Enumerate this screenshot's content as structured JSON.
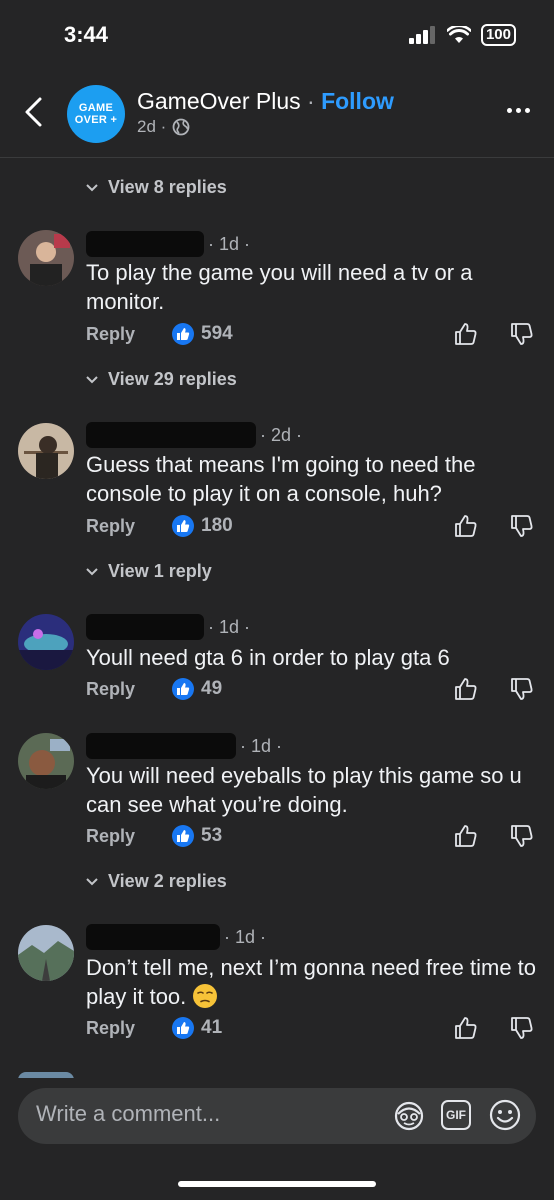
{
  "status_bar": {
    "time": "3:44",
    "battery": "100"
  },
  "header": {
    "page_name": "GameOver Plus",
    "separator": "·",
    "follow_label": "Follow",
    "post_age": "2d ·",
    "logo_line1": "GAME",
    "logo_line2": "OVER +"
  },
  "comments": [
    {
      "replies_toggle": "View 8 replies",
      "name_suffix": "· 1d ·",
      "text": "To play the game you will need a tv or a monitor.",
      "reply_label": "Reply",
      "likes": "594",
      "avatar_color": "#6c5a55"
    },
    {
      "replies_toggle": "View 29 replies",
      "name_suffix": "· 2d ·",
      "text": "Guess that means I'm going to need the console to play it on a console, huh?",
      "reply_label": "Reply",
      "likes": "180",
      "avatar_color": "#c8b8a4"
    },
    {
      "replies_toggle": "View 1 reply",
      "name_suffix": "· 1d ·",
      "text": "Youll need gta 6 in order to play gta 6",
      "reply_label": "Reply",
      "likes": "49",
      "avatar_color": "#3a3f9c"
    },
    {
      "replies_toggle": "",
      "name_suffix": "· 1d ·",
      "text": "You will need eyeballs to play this game so u can see what you’re doing.",
      "reply_label": "Reply",
      "likes": "53",
      "avatar_color": "#5b6a55"
    },
    {
      "replies_toggle": "View 2 replies",
      "name_suffix": "· 1d ·",
      "text": "Don’t tell me, next I’m gonna need free time to play it too.",
      "reply_label": "Reply",
      "likes": "41",
      "avatar_color": "#a9b9cc"
    }
  ],
  "composer": {
    "placeholder": "Write a comment...",
    "gif_label": "GIF"
  },
  "colors": {
    "accent": "#2e9cff",
    "like": "#1877f2",
    "background": "#252526"
  },
  "icons": [
    "back-chevron-icon",
    "globe-icon",
    "more-icon",
    "thumbs-up-icon",
    "thumbs-down-icon",
    "avatar-sticker-icon",
    "gif-icon",
    "emoji-icon"
  ]
}
